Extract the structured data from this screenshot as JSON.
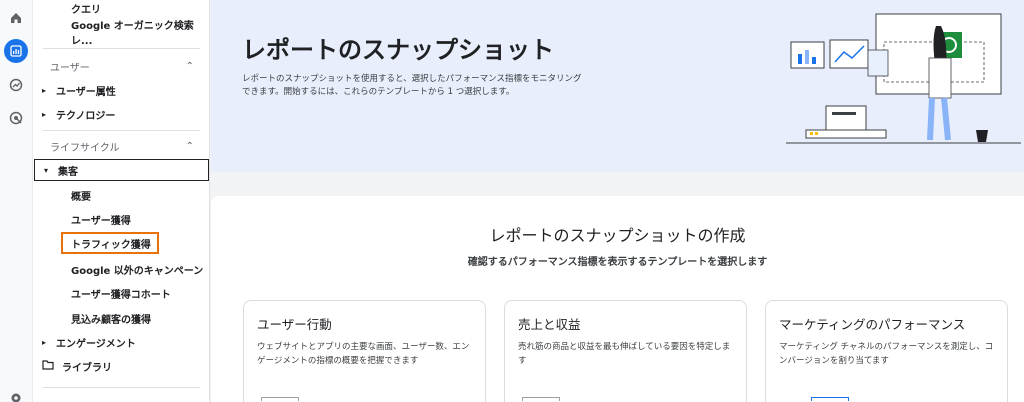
{
  "rail": {
    "icons": [
      "home-icon",
      "reports-icon",
      "explore-icon",
      "advertising-icon",
      "settings-icon"
    ]
  },
  "sidebar": {
    "top_items": [
      "クエリ",
      "Google オーガニック検索レ..."
    ],
    "user_section": "ユーザー",
    "user_items": [
      "ユーザー属性",
      "テクノロジー"
    ],
    "lifecycle_section": "ライフサイクル",
    "acquisition": "集客",
    "acquisition_items": [
      "概要",
      "ユーザー獲得",
      "トラフィック獲得",
      "Google 以外のキャンペーン",
      "ユーザー獲得コホート",
      "見込み顧客の獲得"
    ],
    "engagement": "エンゲージメント",
    "library": "ライブラリ"
  },
  "hero": {
    "title": "レポートのスナップショット",
    "description": "レポートのスナップショットを使用すると、選択したパフォーマンス指標をモニタリングできます。開始するには、これらのテンプレートから 1 つ選択します。"
  },
  "main": {
    "title": "レポートのスナップショットの作成",
    "subtitle": "確認するパフォーマンス指標を表示するテンプレートを選択します",
    "cards": [
      {
        "title": "ユーザー行動",
        "description": "ウェブサイトとアプリの主要な画面、ユーザー数、エンゲージメントの指標の概要を把握できます"
      },
      {
        "title": "売上と収益",
        "description": "売れ筋の商品と収益を最も伸ばしている要因を特定します"
      },
      {
        "title": "マーケティングのパフォーマンス",
        "description": "マーケティング チャネルのパフォーマンスを測定し、コンバージョンを割り当てます"
      }
    ]
  },
  "colors": {
    "accent": "#1a73e8",
    "highlight": "#e8710a",
    "hero_bg": "#e8eefb",
    "illustration_green": "#1e8e3e"
  }
}
